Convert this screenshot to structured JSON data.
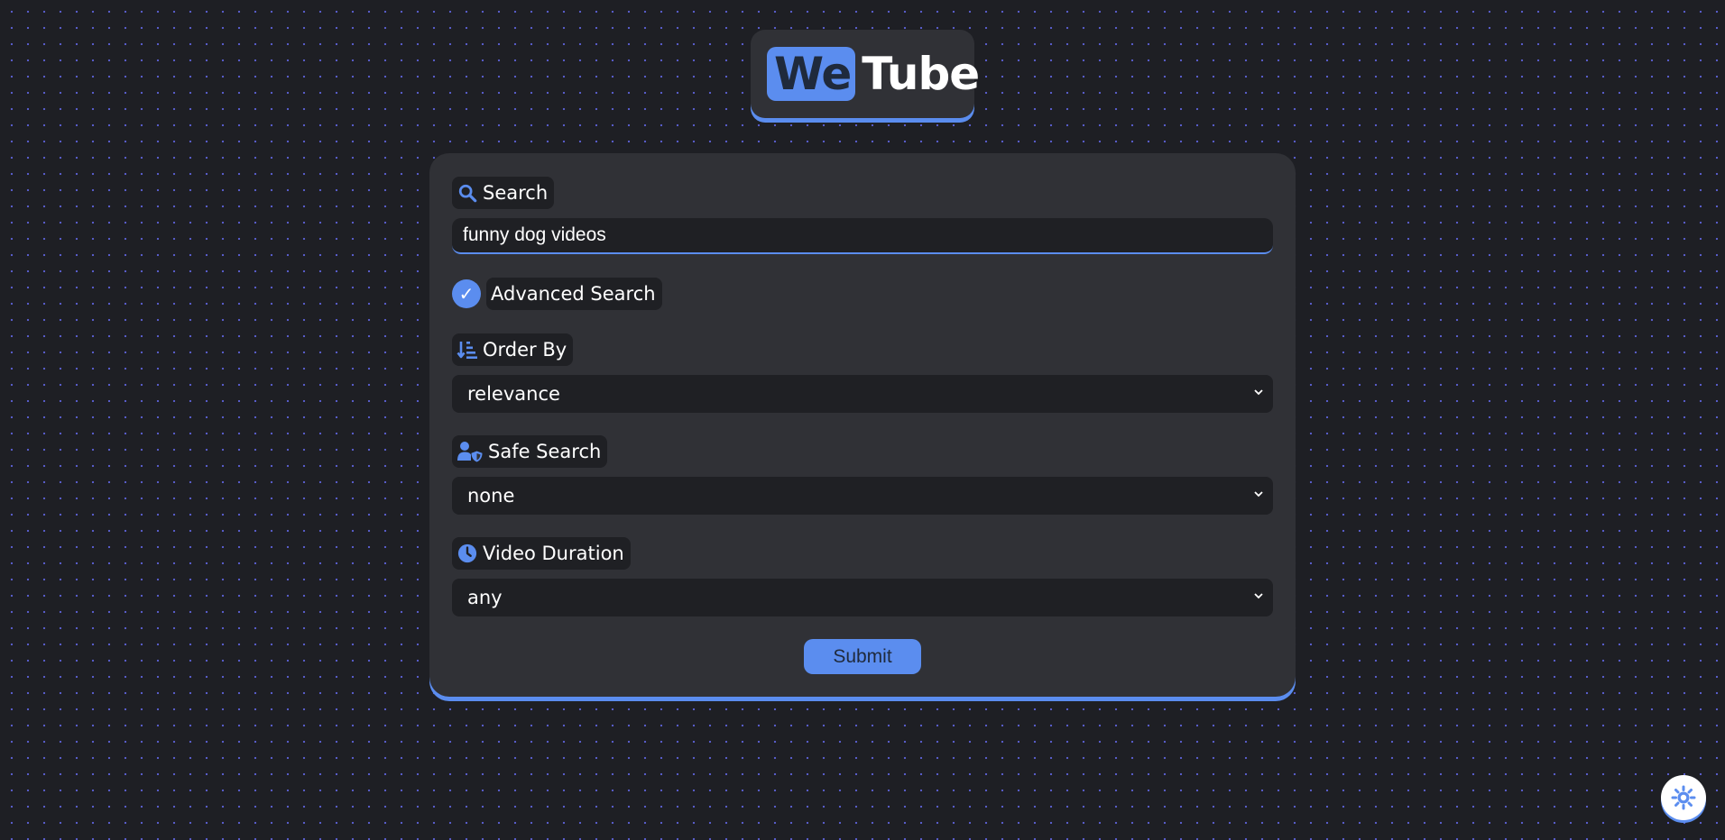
{
  "logo": {
    "part1": "We",
    "part2": "Tube"
  },
  "form": {
    "search_label": "Search",
    "search_value": "funny dog videos",
    "advanced_label": "Advanced Search",
    "advanced_checked": true,
    "order_label": "Order By",
    "order_value": "relevance",
    "safe_label": "Safe Search",
    "safe_value": "none",
    "duration_label": "Video Duration",
    "duration_value": "any",
    "submit_label": "Submit"
  },
  "icons": {
    "search": "search-icon",
    "check": "checkmark-icon",
    "order": "sort-amount-down-icon",
    "safe": "user-shield-icon",
    "duration": "clock-icon",
    "theme": "sun-icon"
  },
  "colors": {
    "accent": "#5b8def",
    "background": "#1e1f24",
    "card": "#303136",
    "field": "#1f2024"
  }
}
